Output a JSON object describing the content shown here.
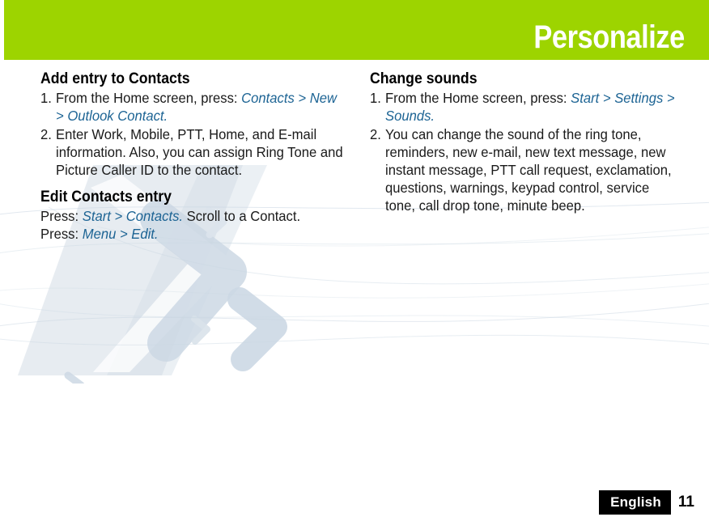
{
  "header": {
    "title": "Personalize",
    "bar_color": "#9dd400"
  },
  "theme": {
    "accent_green": "#9dd400",
    "command_blue": "#1d6494",
    "body_text": "#1a1a1a",
    "watermark_blue": "#d3dde6"
  },
  "left_column": {
    "sections": [
      {
        "heading": "Add entry to Contacts",
        "steps": [
          {
            "number": "1.",
            "parts": [
              {
                "text": "From the Home screen, press: ",
                "style": "plain"
              },
              {
                "text": "Contacts > New > Outlook Contact.",
                "style": "command"
              }
            ]
          },
          {
            "number": "2.",
            "parts": [
              {
                "text": "Enter Work, Mobile, PTT, Home, and E-mail information. Also, you can assign Ring Tone and Picture Caller ID to the contact.",
                "style": "plain"
              }
            ]
          }
        ]
      },
      {
        "heading": "Edit Contacts entry",
        "paragraphs": [
          {
            "parts": [
              {
                "text": "Press: ",
                "style": "plain"
              },
              {
                "text": "Start > Contacts.",
                "style": "command"
              },
              {
                "text": " Scroll to a Contact.",
                "style": "plain"
              }
            ]
          },
          {
            "parts": [
              {
                "text": "Press: ",
                "style": "plain"
              },
              {
                "text": "Menu > Edit.",
                "style": "command"
              }
            ]
          }
        ]
      }
    ]
  },
  "right_column": {
    "sections": [
      {
        "heading": "Change sounds",
        "steps": [
          {
            "number": "1.",
            "parts": [
              {
                "text": "From the Home screen, press: ",
                "style": "plain"
              },
              {
                "text": "Start > Settings > Sounds.",
                "style": "command"
              }
            ]
          },
          {
            "number": "2.",
            "parts": [
              {
                "text": "You can change the sound of the ring tone, reminders, new e-mail, new text message, new instant message, PTT call request, exclamation, questions, warnings, keypad control, service tone, call drop tone, minute beep.",
                "style": "plain"
              }
            ]
          }
        ]
      }
    ]
  },
  "footer": {
    "language": "English",
    "page_number": "11"
  }
}
